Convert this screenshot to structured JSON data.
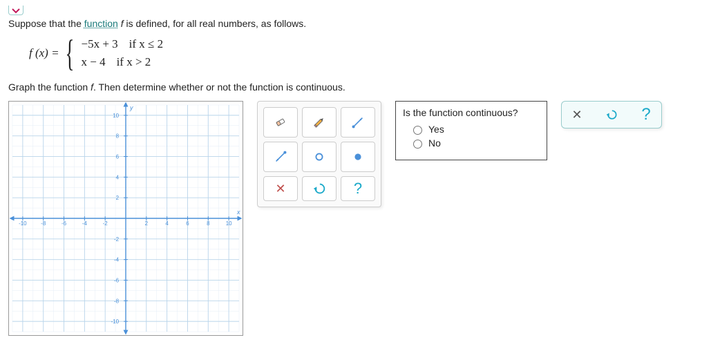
{
  "question": {
    "intro_pre": "Suppose that the ",
    "intro_link": "function",
    "intro_mid": " ",
    "intro_post": " is defined, for all real numbers, as follows.",
    "fx_label": "f (x) =",
    "piece1_expr": "−5x + 3",
    "piece1_cond": "if x ≤ 2",
    "piece2_expr": "x − 4",
    "piece2_cond": "if x > 2",
    "instr2_pre": "Graph the function ",
    "instr2_post": ". Then determine whether or not the function is continuous."
  },
  "graph": {
    "xmin": -10,
    "xmax": 10,
    "ymin": -10,
    "ymax": 10,
    "xticks": [
      -10,
      -8,
      -6,
      -4,
      -2,
      2,
      4,
      6,
      8,
      10
    ],
    "yticks": [
      -10,
      -8,
      -6,
      -4,
      -2,
      2,
      4,
      6,
      8,
      10
    ],
    "xlabel": "x",
    "ylabel": "y"
  },
  "continuity": {
    "title": "Is the function continuous?",
    "opt_yes": "Yes",
    "opt_no": "No"
  },
  "tools": {
    "eraser": "eraser",
    "pencil": "pencil",
    "ray_ne": "ray-up",
    "ray_sw": "ray-down",
    "open_point": "open-point",
    "closed_point": "closed-point",
    "clear": "clear",
    "undo": "undo",
    "help": "help"
  },
  "actions": {
    "close": "close",
    "reset": "reset",
    "help": "help"
  },
  "chart_data": {
    "type": "line",
    "title": "",
    "xlabel": "x",
    "ylabel": "y",
    "xlim": [
      -11,
      11
    ],
    "ylim": [
      -11,
      11
    ],
    "series": [],
    "grid": true,
    "note": "empty coordinate grid for student to plot piecewise function"
  }
}
